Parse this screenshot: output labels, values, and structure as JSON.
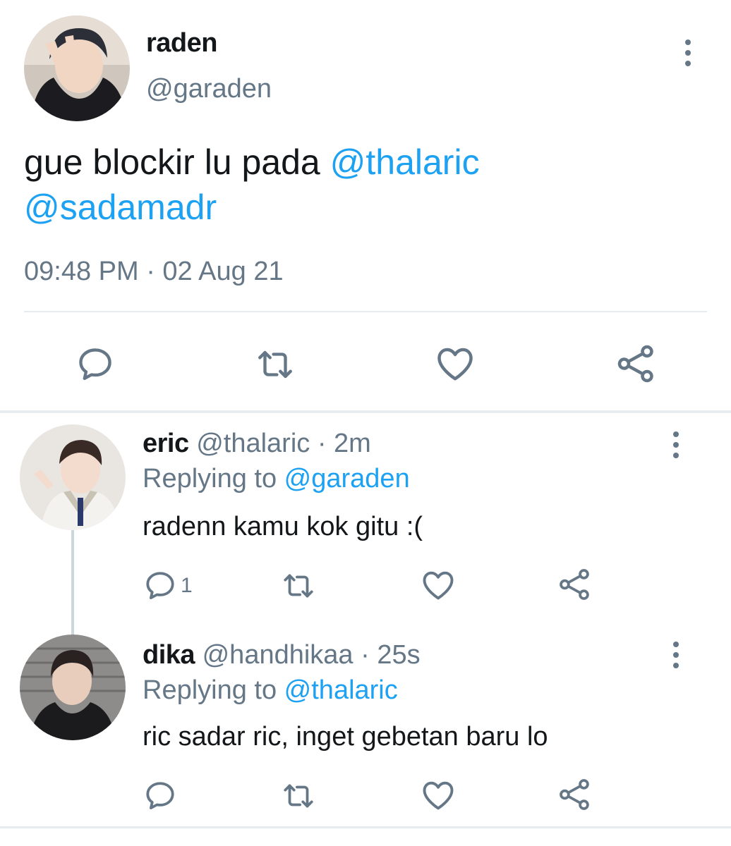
{
  "main": {
    "name": "raden",
    "handle": "@garaden",
    "text_plain": "gue blockir lu pada ",
    "mention1": "@thalaric",
    "mention2": "@sadamadr",
    "timestamp": "09:48 PM · 02 Aug 21"
  },
  "replies": [
    {
      "name": "eric",
      "handle_time": "@thalaric · 2m",
      "replying_prefix": "Replying to ",
      "replying_handle": "@garaden",
      "text": "radenn kamu kok gitu :(",
      "reply_count": "1"
    },
    {
      "name": "dika",
      "handle_time": "@handhikaa · 25s",
      "replying_prefix": "Replying to ",
      "replying_handle": "@thalaric",
      "text": "ric sadar ric, inget gebetan baru lo",
      "reply_count": ""
    }
  ],
  "icons": [
    "comment-icon",
    "retweet-icon",
    "like-icon",
    "share-icon",
    "more-icon"
  ],
  "colors": {
    "accent": "#1da1f2",
    "muted": "#657786",
    "text": "#14171a",
    "divider": "#e6ecf0"
  }
}
